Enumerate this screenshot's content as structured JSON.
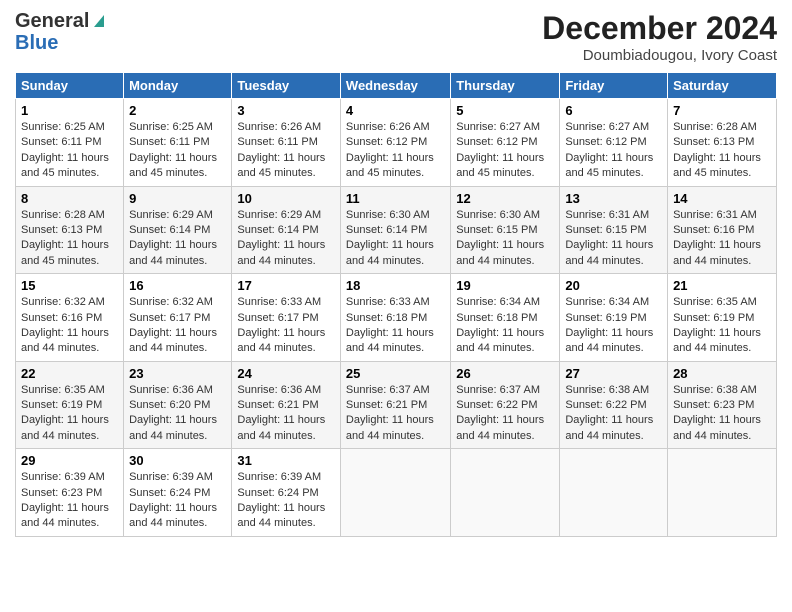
{
  "header": {
    "logo_general": "General",
    "logo_blue": "Blue",
    "month": "December 2024",
    "location": "Doumbiadougou, Ivory Coast"
  },
  "weekdays": [
    "Sunday",
    "Monday",
    "Tuesday",
    "Wednesday",
    "Thursday",
    "Friday",
    "Saturday"
  ],
  "weeks": [
    [
      {
        "day": "1",
        "sunrise": "6:25 AM",
        "sunset": "6:11 PM",
        "daylight": "11 hours and 45 minutes."
      },
      {
        "day": "2",
        "sunrise": "6:25 AM",
        "sunset": "6:11 PM",
        "daylight": "11 hours and 45 minutes."
      },
      {
        "day": "3",
        "sunrise": "6:26 AM",
        "sunset": "6:11 PM",
        "daylight": "11 hours and 45 minutes."
      },
      {
        "day": "4",
        "sunrise": "6:26 AM",
        "sunset": "6:12 PM",
        "daylight": "11 hours and 45 minutes."
      },
      {
        "day": "5",
        "sunrise": "6:27 AM",
        "sunset": "6:12 PM",
        "daylight": "11 hours and 45 minutes."
      },
      {
        "day": "6",
        "sunrise": "6:27 AM",
        "sunset": "6:12 PM",
        "daylight": "11 hours and 45 minutes."
      },
      {
        "day": "7",
        "sunrise": "6:28 AM",
        "sunset": "6:13 PM",
        "daylight": "11 hours and 45 minutes."
      }
    ],
    [
      {
        "day": "8",
        "sunrise": "6:28 AM",
        "sunset": "6:13 PM",
        "daylight": "11 hours and 45 minutes."
      },
      {
        "day": "9",
        "sunrise": "6:29 AM",
        "sunset": "6:14 PM",
        "daylight": "11 hours and 44 minutes."
      },
      {
        "day": "10",
        "sunrise": "6:29 AM",
        "sunset": "6:14 PM",
        "daylight": "11 hours and 44 minutes."
      },
      {
        "day": "11",
        "sunrise": "6:30 AM",
        "sunset": "6:14 PM",
        "daylight": "11 hours and 44 minutes."
      },
      {
        "day": "12",
        "sunrise": "6:30 AM",
        "sunset": "6:15 PM",
        "daylight": "11 hours and 44 minutes."
      },
      {
        "day": "13",
        "sunrise": "6:31 AM",
        "sunset": "6:15 PM",
        "daylight": "11 hours and 44 minutes."
      },
      {
        "day": "14",
        "sunrise": "6:31 AM",
        "sunset": "6:16 PM",
        "daylight": "11 hours and 44 minutes."
      }
    ],
    [
      {
        "day": "15",
        "sunrise": "6:32 AM",
        "sunset": "6:16 PM",
        "daylight": "11 hours and 44 minutes."
      },
      {
        "day": "16",
        "sunrise": "6:32 AM",
        "sunset": "6:17 PM",
        "daylight": "11 hours and 44 minutes."
      },
      {
        "day": "17",
        "sunrise": "6:33 AM",
        "sunset": "6:17 PM",
        "daylight": "11 hours and 44 minutes."
      },
      {
        "day": "18",
        "sunrise": "6:33 AM",
        "sunset": "6:18 PM",
        "daylight": "11 hours and 44 minutes."
      },
      {
        "day": "19",
        "sunrise": "6:34 AM",
        "sunset": "6:18 PM",
        "daylight": "11 hours and 44 minutes."
      },
      {
        "day": "20",
        "sunrise": "6:34 AM",
        "sunset": "6:19 PM",
        "daylight": "11 hours and 44 minutes."
      },
      {
        "day": "21",
        "sunrise": "6:35 AM",
        "sunset": "6:19 PM",
        "daylight": "11 hours and 44 minutes."
      }
    ],
    [
      {
        "day": "22",
        "sunrise": "6:35 AM",
        "sunset": "6:19 PM",
        "daylight": "11 hours and 44 minutes."
      },
      {
        "day": "23",
        "sunrise": "6:36 AM",
        "sunset": "6:20 PM",
        "daylight": "11 hours and 44 minutes."
      },
      {
        "day": "24",
        "sunrise": "6:36 AM",
        "sunset": "6:21 PM",
        "daylight": "11 hours and 44 minutes."
      },
      {
        "day": "25",
        "sunrise": "6:37 AM",
        "sunset": "6:21 PM",
        "daylight": "11 hours and 44 minutes."
      },
      {
        "day": "26",
        "sunrise": "6:37 AM",
        "sunset": "6:22 PM",
        "daylight": "11 hours and 44 minutes."
      },
      {
        "day": "27",
        "sunrise": "6:38 AM",
        "sunset": "6:22 PM",
        "daylight": "11 hours and 44 minutes."
      },
      {
        "day": "28",
        "sunrise": "6:38 AM",
        "sunset": "6:23 PM",
        "daylight": "11 hours and 44 minutes."
      }
    ],
    [
      {
        "day": "29",
        "sunrise": "6:39 AM",
        "sunset": "6:23 PM",
        "daylight": "11 hours and 44 minutes."
      },
      {
        "day": "30",
        "sunrise": "6:39 AM",
        "sunset": "6:24 PM",
        "daylight": "11 hours and 44 minutes."
      },
      {
        "day": "31",
        "sunrise": "6:39 AM",
        "sunset": "6:24 PM",
        "daylight": "11 hours and 44 minutes."
      },
      null,
      null,
      null,
      null
    ]
  ]
}
